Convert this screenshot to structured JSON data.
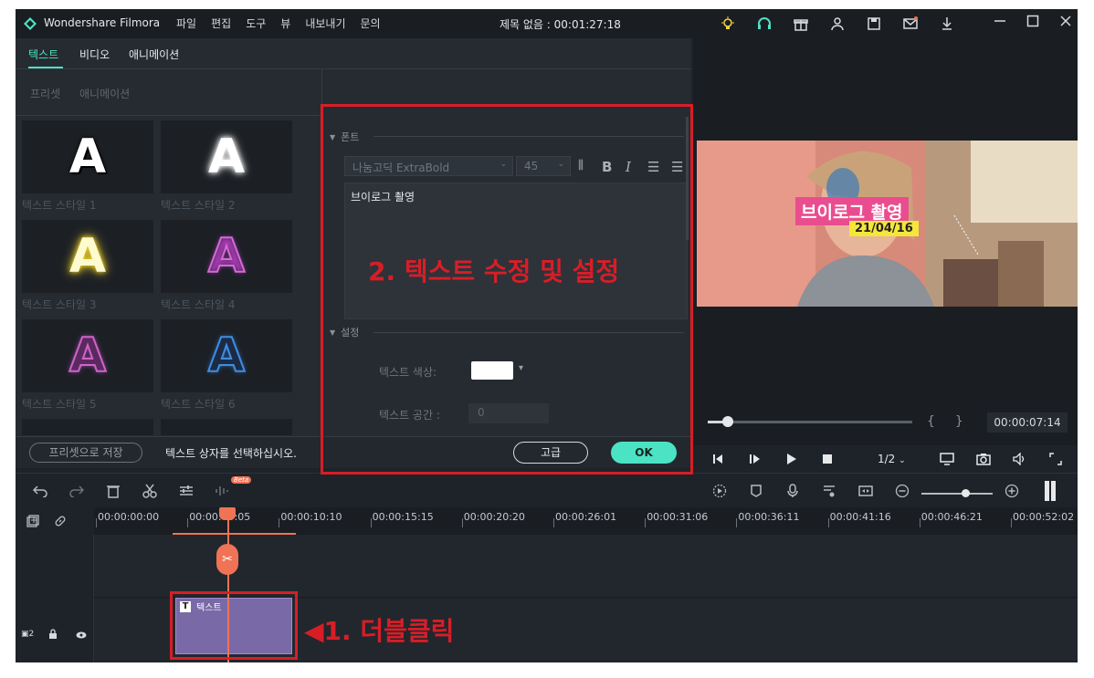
{
  "app": {
    "name": "Wondershare Filmora",
    "title": "제목 없음 : 00:01:27:18"
  },
  "menu": [
    "파일",
    "편집",
    "도구",
    "뷰",
    "내보내기",
    "문의"
  ],
  "tabs": {
    "text": "텍스트",
    "video": "비디오",
    "animation": "애니메이션"
  },
  "subtabs": {
    "preset": "프리셋",
    "animation": "애니메이션"
  },
  "styles": [
    {
      "label": "텍스트 스타일 1"
    },
    {
      "label": "텍스트 스타일 2"
    },
    {
      "label": "텍스트 스타일 3"
    },
    {
      "label": "텍스트 스타일 4"
    },
    {
      "label": "텍스트 스타일 5"
    },
    {
      "label": "텍스트 스타일 6"
    }
  ],
  "thumb_letter": "A",
  "font_section": {
    "header": "폰트",
    "font_name": "나눔고딕 ExtraBold",
    "font_size": "45",
    "bold": "B",
    "italic": "I",
    "text_value": "브이로그 촬영"
  },
  "settings_section": {
    "header": "설정",
    "color_label": "텍스트 색상:",
    "color_value": "#ffffff",
    "spacing_label": "텍스트 공간 :",
    "spacing_value": "0"
  },
  "bottom": {
    "save_preset": "프리셋으로 저장",
    "hint": "텍스트 상자를 선택하십시오.",
    "advanced": "고급",
    "ok": "OK"
  },
  "preview": {
    "title_text": "브이로그 촬영",
    "date_text": "21/04/16",
    "time": "00:00:07:14",
    "bracket_in": "{",
    "bracket_out": "}",
    "quality": "1/2",
    "progress": 0.1
  },
  "timeline": {
    "ticks": [
      "00:00:00:00",
      "00:00:05:05",
      "00:00:10:10",
      "00:00:15:15",
      "00:00:20:20",
      "00:00:26:01",
      "00:00:31:06",
      "00:00:36:11",
      "00:00:41:16",
      "00:00:46:21",
      "00:00:52:02"
    ],
    "clip_label": "텍스트",
    "track_num": "2",
    "beta": "Beta"
  },
  "annotations": {
    "step1": "◀1. 더블클릭",
    "step2": "2. 텍스트 수정 및 설정",
    "color": "#d71e27"
  },
  "colors": {
    "accent": "#4be3c3",
    "playhead": "#f07356",
    "clip": "#7a69a7"
  }
}
